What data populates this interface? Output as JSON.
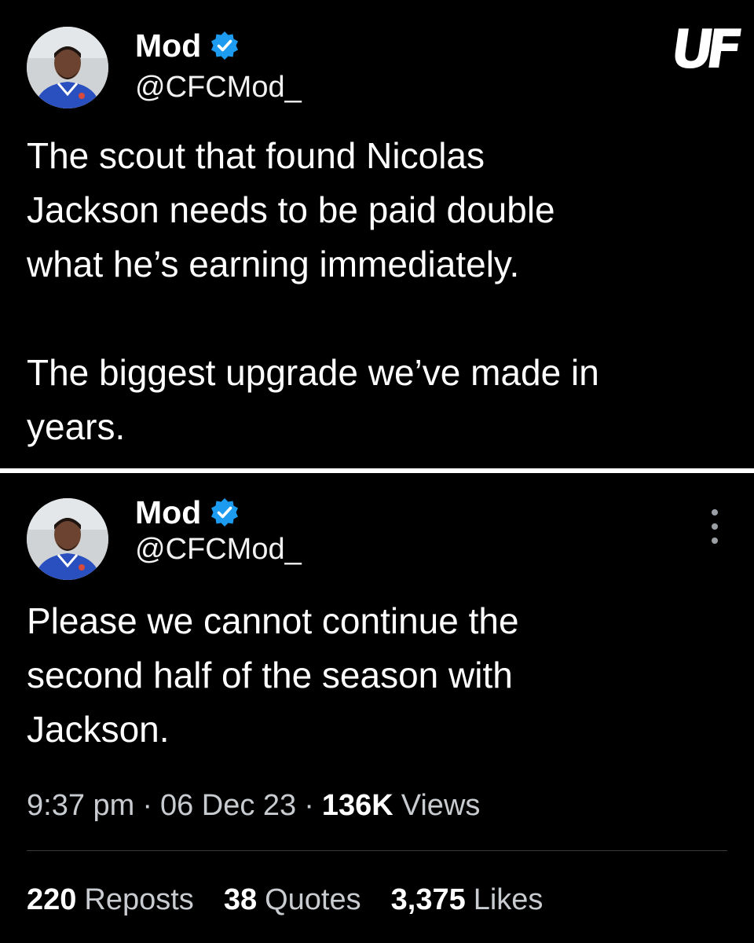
{
  "watermark": "UF",
  "colors": {
    "background": "#000000",
    "verified_badge": "#1d9bf0",
    "divider": "#ffffff"
  },
  "tweets": [
    {
      "author_name": "Mod",
      "handle": "@CFCMod_",
      "verified_icon": "verified-badge-icon",
      "text": "The scout that found Nicolas\nJackson needs to be paid double\nwhat he’s earning immediately.\n\nThe biggest upgrade we’ve made in\nyears."
    },
    {
      "author_name": "Mod",
      "handle": "@CFCMod_",
      "verified_icon": "verified-badge-icon",
      "text": "Please we cannot continue the\nsecond half of the season with\nJackson.",
      "time": "9:37 pm",
      "separator": "·",
      "date": "06 Dec 23",
      "views_count": "136K",
      "views_label": "Views",
      "reposts_count": "220",
      "reposts_label": "Reposts",
      "quotes_count": "38",
      "quotes_label": "Quotes",
      "likes_count": "3,375",
      "likes_label": "Likes"
    }
  ]
}
